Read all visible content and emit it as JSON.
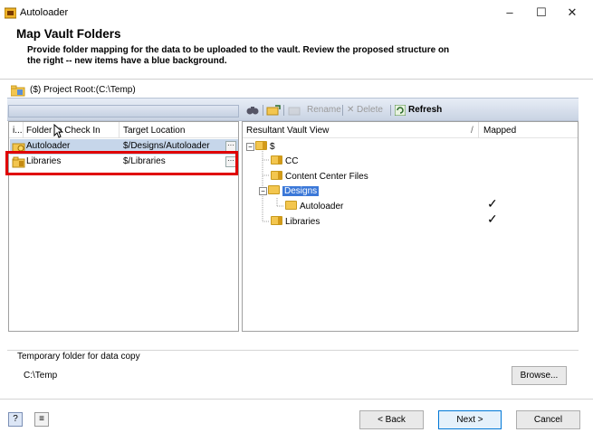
{
  "window": {
    "title": "Autoloader",
    "controls": [
      "–",
      "☐",
      "✕"
    ]
  },
  "header": {
    "title": "Map Vault Folders",
    "description": "Provide folder mapping for the data to be uploaded to the vault. Review the proposed structure on the right -- new items have a blue background."
  },
  "root": {
    "label": "($) Project Root:(C:\\Temp)"
  },
  "left_pane": {
    "columns": [
      "i...",
      "Folder to Check In",
      "Target Location"
    ],
    "rows": [
      {
        "folder": "Autoloader",
        "target": "$/Designs/Autoloader",
        "selected": true
      },
      {
        "folder": "Libraries",
        "target": "$/Libraries",
        "selected": false
      }
    ]
  },
  "right_toolbar": {
    "rename": "Rename",
    "delete": "Delete",
    "refresh": "Refresh"
  },
  "right_pane": {
    "columns": [
      "Resultant Vault View",
      "/",
      "Mapped"
    ],
    "tree": [
      {
        "label": "$",
        "level": 0,
        "mapped": false
      },
      {
        "label": "CC",
        "level": 1,
        "mapped": false
      },
      {
        "label": "Content Center Files",
        "level": 1,
        "mapped": false
      },
      {
        "label": "Designs",
        "level": 1,
        "mapped": false,
        "new": true
      },
      {
        "label": "Autoloader",
        "level": 2,
        "mapped": true
      },
      {
        "label": "Libraries",
        "level": 1,
        "mapped": true
      }
    ],
    "check_glyph": "✓"
  },
  "temp_folder": {
    "label": "Temporary folder for data copy",
    "path": "C:\\Temp",
    "browse_label": "Browse..."
  },
  "footer": {
    "back_label": "< Back",
    "next_label": "Next >",
    "cancel_label": "Cancel"
  },
  "colors": {
    "highlight": "#e00000",
    "new_item_bg": "#3b78d8",
    "selected_row_bg": "#c6d6ea"
  }
}
